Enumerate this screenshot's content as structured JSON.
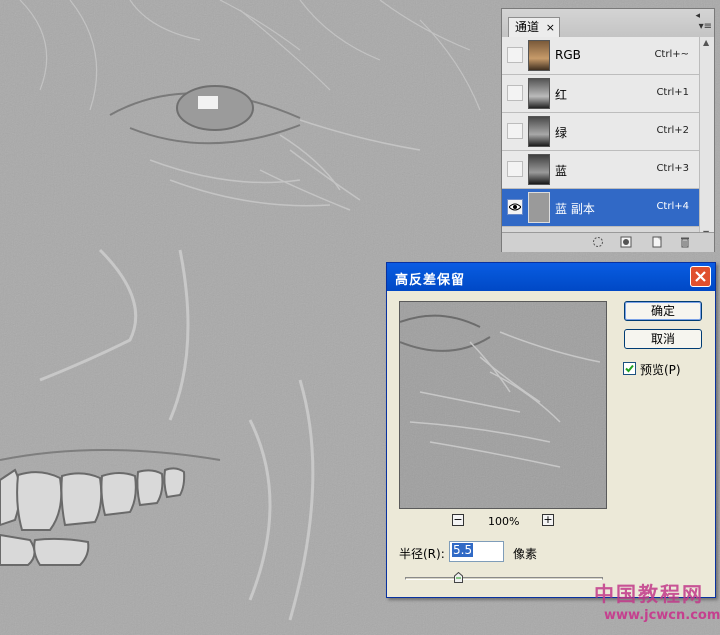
{
  "channels_panel": {
    "tab_label": "通道",
    "tab_close": "×",
    "collapse_glyph": "◂",
    "menu_glyph": "▾≡",
    "channels": [
      {
        "name": "RGB",
        "shortcut": "Ctrl+~",
        "visible": false,
        "selected": false
      },
      {
        "name": "红",
        "shortcut": "Ctrl+1",
        "visible": false,
        "selected": false
      },
      {
        "name": "绿",
        "shortcut": "Ctrl+2",
        "visible": false,
        "selected": false
      },
      {
        "name": "蓝",
        "shortcut": "Ctrl+3",
        "visible": false,
        "selected": false
      },
      {
        "name": "蓝 副本",
        "shortcut": "Ctrl+4",
        "visible": true,
        "selected": true
      }
    ],
    "footer_icons": [
      "load-selection-icon",
      "save-selection-icon",
      "new-channel-icon",
      "trash-icon"
    ]
  },
  "dialog": {
    "title": "高反差保留",
    "ok_label": "确定",
    "cancel_label": "取消",
    "preview_label": "预览(P)",
    "preview_checked": true,
    "zoom_out": "−",
    "zoom_in": "+",
    "zoom_value": "100%",
    "radius_label": "半径(R):",
    "radius_value": "5.5",
    "radius_unit": "像素",
    "radius_slider_fraction": 0.27
  },
  "watermark": {
    "text": "中国教程网",
    "url": "www.jcwcn.com"
  },
  "colors": {
    "selection": "#3169c6",
    "titlebar": "#0055d6",
    "dialog_bg": "#ece9d8",
    "photo_gray": "#a9a9a9"
  }
}
